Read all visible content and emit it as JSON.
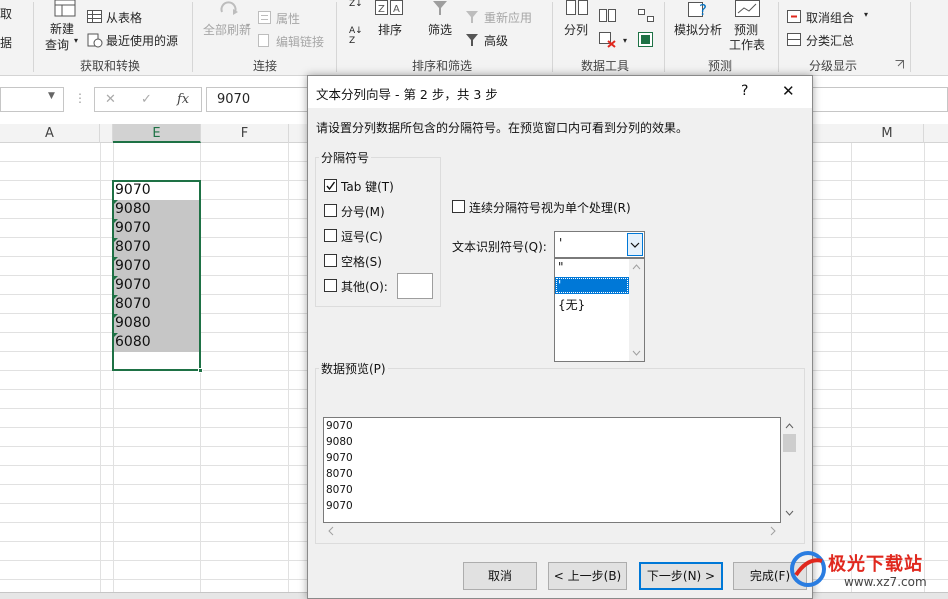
{
  "ribbon": {
    "partial_left_top": "取",
    "partial_left_bottom": "据",
    "new_query_top": "新建",
    "new_query_bottom": "查询",
    "from_table": "从表格",
    "recent_sources": "最近使用的源",
    "refresh_all": "全部刷新",
    "properties": "属性",
    "edit_links": "编辑链接",
    "sort": "排序",
    "filter": "筛选",
    "reapply": "重新应用",
    "advanced": "高级",
    "split_columns": "分列",
    "what_if": "模拟分析",
    "forecast_top": "预测",
    "forecast_bottom": "工作表",
    "ungroup": "取消组合",
    "subtotal": "分类汇总",
    "sort_az": "A↓Z",
    "groups": {
      "get_transform": "获取和转换",
      "connections": "连接",
      "sort_filter": "排序和筛选",
      "data_tools": "数据工具",
      "forecast": "预测",
      "outline": "分级显示"
    }
  },
  "formula_bar": {
    "value": "9070",
    "cancel_symbol": "✕",
    "enter_symbol": "✓",
    "fx_symbol": "fx"
  },
  "sheet": {
    "columns": [
      "A",
      "E",
      "F",
      "M"
    ],
    "cells": [
      "9070",
      "9080",
      "9070",
      "8070",
      "9070",
      "9070",
      "8070",
      "9080",
      "6080"
    ]
  },
  "dialog": {
    "title": "文本分列向导 - 第 2 步，共 3 步",
    "help": "?",
    "close": "✕",
    "instruction": "请设置分列数据所包含的分隔符号。在预览窗口内可看到分列的效果。",
    "delimiters_group": "分隔符号",
    "delimiters": [
      {
        "label": "Tab 键(T)",
        "checked": true
      },
      {
        "label": "分号(M)",
        "checked": false
      },
      {
        "label": "逗号(C)",
        "checked": false
      },
      {
        "label": "空格(S)",
        "checked": false
      },
      {
        "label": "其他(O):",
        "checked": false
      }
    ],
    "consecutive_label": "连续分隔符号视为单个处理(R)",
    "text_qualifier_label": "文本识别符号(Q):",
    "text_qualifier_value": "'",
    "dropdown_options": [
      "\"",
      "'",
      "{无}"
    ],
    "dropdown_selected_index": 1,
    "preview_label": "数据预览(P)",
    "preview_rows": [
      "9070",
      "9080",
      "9070",
      "8070",
      "8070",
      "9070"
    ],
    "buttons": {
      "cancel": "取消",
      "back": "< 上一步(B)",
      "next": "下一步(N) >",
      "finish": "完成(F)"
    }
  },
  "watermark": {
    "text": "极光下载站",
    "url": "www.xz7.com"
  },
  "colors": {
    "excel_green": "#1e7145",
    "selection_gray": "#c6c6c6",
    "highlight_blue": "#0078d7",
    "watermark_red": "#e0281e"
  }
}
